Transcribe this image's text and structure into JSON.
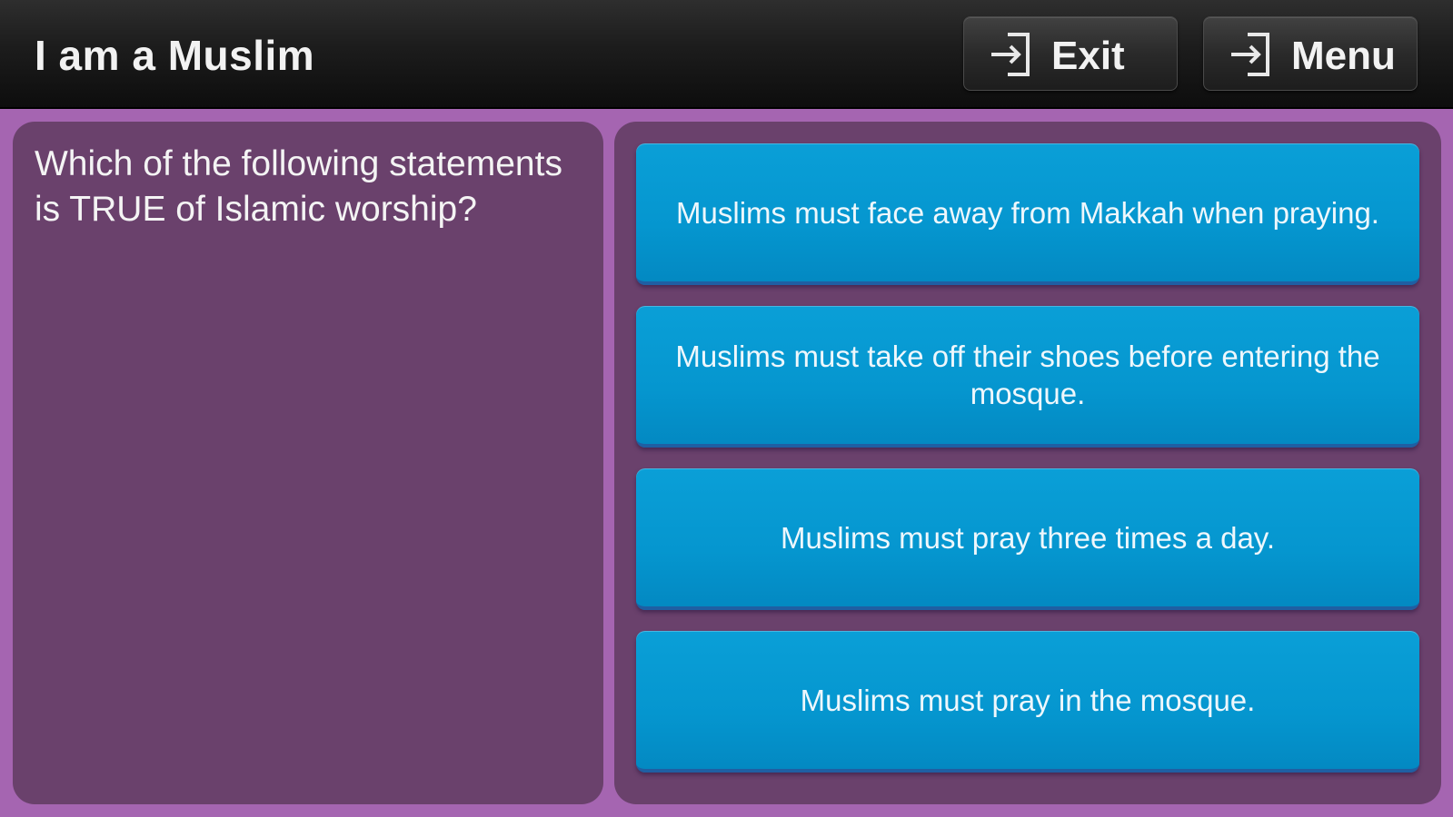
{
  "header": {
    "title": "I am a Muslim",
    "exit_label": "Exit",
    "menu_label": "Menu",
    "exit_icon": "exit-arrow-icon",
    "menu_icon": "exit-arrow-icon"
  },
  "question": {
    "text": "Which of the following statements is TRUE of Islamic worship?"
  },
  "answers": [
    {
      "text": "Muslims must face away from Makkah when praying."
    },
    {
      "text": "Muslims must take off their shoes before entering the mosque."
    },
    {
      "text": "Muslims must pray three times a day."
    },
    {
      "text": "Muslims must pray in the mosque."
    }
  ],
  "colors": {
    "background": "#a565b1",
    "panel": "#6a416c",
    "answer_button": "#0596cf",
    "topbar": "#1c1c1c"
  }
}
